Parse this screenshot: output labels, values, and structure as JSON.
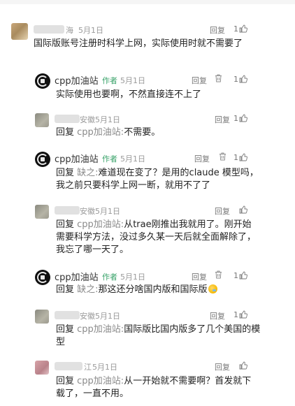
{
  "icons": {
    "like": "thumbs-up-icon",
    "delete": "trash-icon"
  },
  "colors": {
    "author_tag": "#3aa36a",
    "meta": "#9a9a9a"
  },
  "comments": [
    {
      "name_tail": "海",
      "date": "5月1日",
      "reply_label": "回复",
      "likes": "1",
      "text": "国际版账号注册时科学上网，实际使用时就不需要了"
    },
    {
      "name": "cpp加油站",
      "author_tag": "作者",
      "date": "5月1日",
      "reply_label": "回复",
      "likes": "1",
      "text": "实际使用也要啊，不然直接连不上了"
    },
    {
      "name_tail": "安徽",
      "date": "5月1日",
      "reply_label": "回复",
      "likes": "1",
      "reply_kw": "回复",
      "reply_target": "cpp加油站:",
      "text": "不需要。"
    },
    {
      "name": "cpp加油站",
      "author_tag": "作者",
      "date": "5月1日",
      "reply_label": "回复",
      "likes": "1",
      "reply_kw": "回复",
      "reply_target": "缺之:",
      "text": "难道现在变了？是用的claude 模型吗，我之前只要科学上网一断，就用不了了"
    },
    {
      "name_tail": "安徽",
      "date": "5月1日",
      "reply_label": "回复",
      "reply_kw": "回复",
      "reply_target": "cpp加油站:",
      "text": "从trae刚推出我就用了。刚开始需要科学方法，没过多久某一天后就全面解除了，我忘了哪一天了。"
    },
    {
      "name": "cpp加油站",
      "author_tag": "作者",
      "date": "5月1日",
      "reply_label": "回复",
      "likes": "1",
      "reply_kw": "回复",
      "reply_target": "缺之:",
      "text": "那这还分啥国内版和国际版"
    },
    {
      "name_tail": "安徽",
      "date": "5月1日",
      "reply_label": "回复",
      "likes": "1",
      "reply_kw": "回复",
      "reply_target": "cpp加油站:",
      "text": "国际版比国内版多了几个美国的模型"
    },
    {
      "name_tail": "江",
      "date": "5月1日",
      "reply_label": "回复",
      "reply_kw": "回复",
      "reply_target": "cpp加油站:",
      "text": "从一开始就不需要啊？首发就下载了，一直不用。"
    }
  ]
}
